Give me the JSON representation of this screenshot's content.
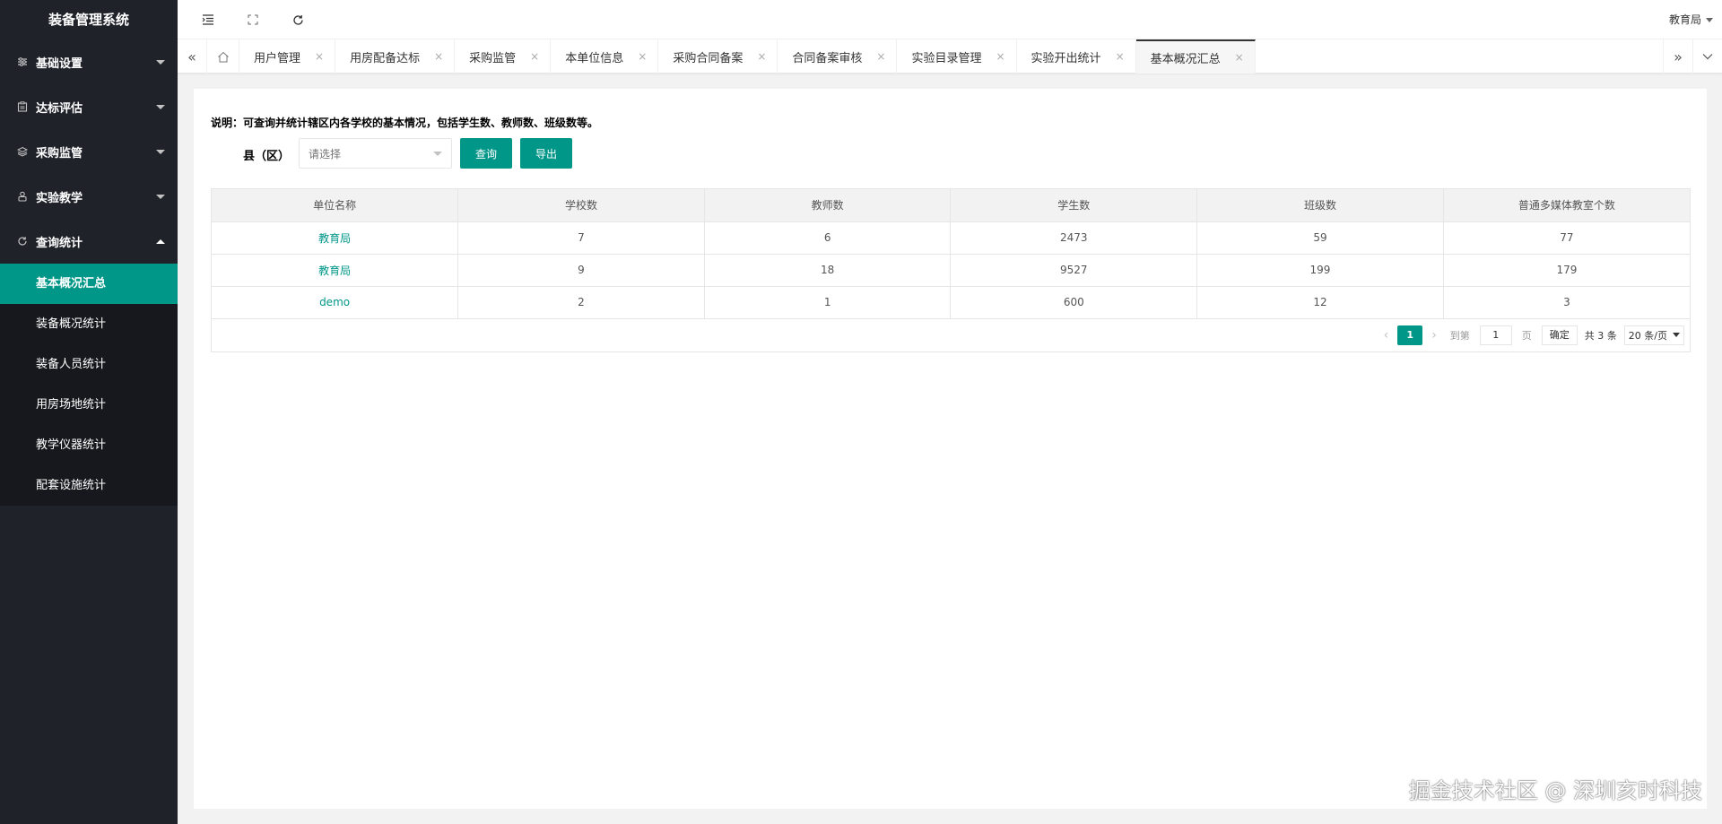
{
  "app": {
    "title": "装备管理系统"
  },
  "sidebar": {
    "items": [
      {
        "label": "基础设置",
        "icon": "sliders-icon",
        "expanded": false
      },
      {
        "label": "达标评估",
        "icon": "clipboard-icon",
        "expanded": false
      },
      {
        "label": "采购监管",
        "icon": "stack-icon",
        "expanded": false
      },
      {
        "label": "实验教学",
        "icon": "flask-icon",
        "expanded": false
      },
      {
        "label": "查询统计",
        "icon": "refresh-icon",
        "expanded": true
      }
    ],
    "subitems": [
      {
        "label": "基本概况汇总",
        "active": true
      },
      {
        "label": "装备概况统计",
        "active": false
      },
      {
        "label": "装备人员统计",
        "active": false
      },
      {
        "label": "用房场地统计",
        "active": false
      },
      {
        "label": "教学仪器统计",
        "active": false
      },
      {
        "label": "配套设施统计",
        "active": false
      }
    ]
  },
  "header": {
    "user": "教育局"
  },
  "tabs": [
    {
      "label": "用户管理",
      "active": false
    },
    {
      "label": "用房配备达标",
      "active": false
    },
    {
      "label": "采购监管",
      "active": false
    },
    {
      "label": "本单位信息",
      "active": false
    },
    {
      "label": "采购合同备案",
      "active": false
    },
    {
      "label": "合同备案审核",
      "active": false
    },
    {
      "label": "实验目录管理",
      "active": false
    },
    {
      "label": "实验开出统计",
      "active": false
    },
    {
      "label": "基本概况汇总",
      "active": true
    }
  ],
  "main": {
    "description": "说明：可查询并统计辖区内各学校的基本情况，包括学生数、教师数、班级数等。",
    "filter_label": "县（区）",
    "select_placeholder": "请选择",
    "query_button": "查询",
    "export_button": "导出",
    "table": {
      "headers": [
        "单位名称",
        "学校数",
        "教师数",
        "学生数",
        "班级数",
        "普通多媒体教室个数"
      ],
      "rows": [
        [
          "教育局",
          "7",
          "6",
          "2473",
          "59",
          "77"
        ],
        [
          "教育局",
          "9",
          "18",
          "9527",
          "199",
          "179"
        ],
        [
          "demo",
          "2",
          "1",
          "600",
          "12",
          "3"
        ]
      ]
    },
    "pager": {
      "current_page": "1",
      "goto_label": "到第",
      "goto_value": "1",
      "page_unit": "页",
      "confirm": "确定",
      "total": "共 3 条",
      "page_size": "20 条/页"
    }
  },
  "watermark": "掘金技术社区 @ 深圳亥时科技",
  "colors": {
    "accent": "#009688",
    "sidebar_bg": "#20222a",
    "submenu_bg": "#17181d"
  }
}
